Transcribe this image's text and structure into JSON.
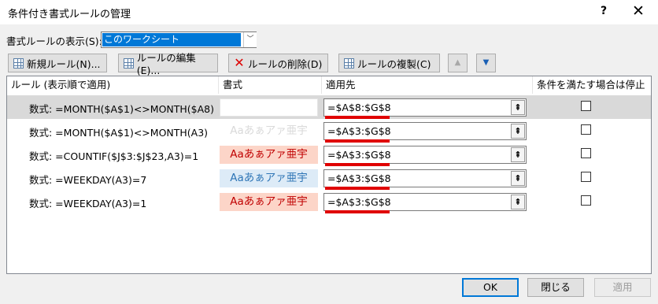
{
  "window": {
    "title": "条件付き書式ルールの管理",
    "help_label": "?",
    "close_label": "✕"
  },
  "show_rules": {
    "label": "書式ルールの表示(S):",
    "selected": "このワークシート",
    "dropdown_glyph": "﹀"
  },
  "toolbar": {
    "new_rule": "新規ルール(N)...",
    "edit_rule": "ルールの編集(E)...",
    "delete_rule": "ルールの削除(D)",
    "duplicate_rule": "ルールの複製(C)",
    "move_up": "▲",
    "move_down": "▼"
  },
  "table": {
    "headers": {
      "rule": "ルール (表示順で適用)",
      "format": "書式",
      "applies_to": "適用先",
      "stop_if_true": "条件を満たす場合は停止"
    },
    "rows": [
      {
        "rule": "数式: =MONTH($A$1)<>MONTH($A8)",
        "preview": "",
        "range": "=$A$8:$G$8",
        "checked": false,
        "selected": true
      },
      {
        "rule": "数式: =MONTH($A$1)<>MONTH(A3)",
        "preview": "Aaあぁアァ亜宇",
        "range": "=$A$3:$G$8",
        "checked": false,
        "selected": false
      },
      {
        "rule": "数式: =COUNTIF($J$3:$J$23,A3)=1",
        "preview": "Aaあぁアァ亜宇",
        "range": "=$A$3:$G$8",
        "checked": false,
        "selected": false
      },
      {
        "rule": "数式: =WEEKDAY(A3)=7",
        "preview": "Aaあぁアァ亜宇",
        "range": "=$A$3:$G$8",
        "checked": false,
        "selected": false
      },
      {
        "rule": "数式: =WEEKDAY(A3)=1",
        "preview": "Aaあぁアァ亜宇",
        "range": "=$A$3:$G$8",
        "checked": false,
        "selected": false
      }
    ],
    "preview_styles": [
      {
        "text_color": "",
        "background": ""
      },
      {
        "text_color": "#d9d9d9",
        "background": "#ffffff"
      },
      {
        "text_color": "#c00000",
        "background": "#fcd5c8"
      },
      {
        "text_color": "#2e75b6",
        "background": "#ddebf7"
      },
      {
        "text_color": "#c00000",
        "background": "#fcd5c8"
      }
    ],
    "collapse_glyph": "⇞"
  },
  "buttons": {
    "ok": "OK",
    "close": "閉じる",
    "apply": "適用"
  }
}
